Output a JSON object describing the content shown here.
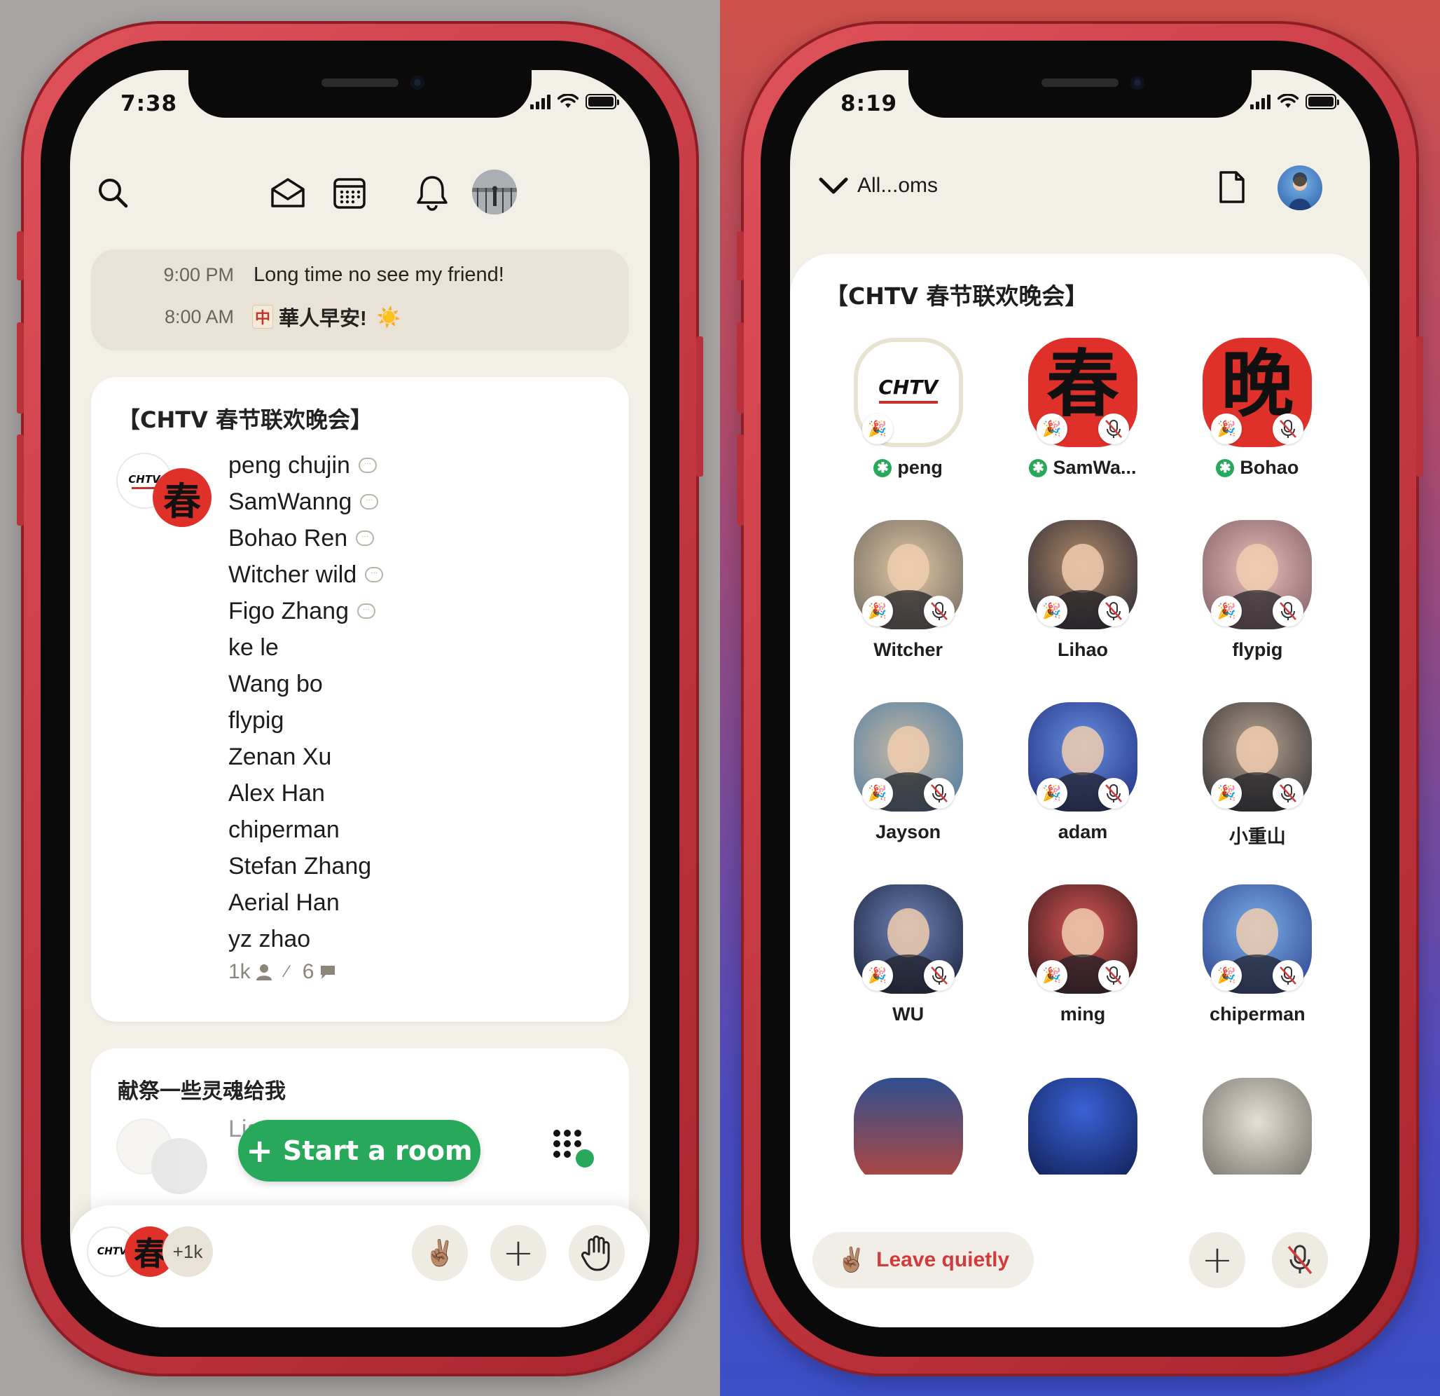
{
  "colors": {
    "accent_green": "#27a85a",
    "leave_red": "#d23b3b",
    "screen_bg": "#f2efe6",
    "phone_red": "#c73a44"
  },
  "left_phone": {
    "status": {
      "time": "7:38"
    },
    "toolbar": {
      "icons": [
        "search-icon",
        "invite-envelope-icon",
        "calendar-icon",
        "bell-icon",
        "profile-avatar"
      ]
    },
    "upcoming": [
      {
        "time": "9:00 PM",
        "title": "Long time no see my friend!",
        "icon": ""
      },
      {
        "time": "8:00 AM",
        "title": "華人早安!",
        "icon": "中",
        "emoji": "☀️"
      }
    ],
    "room": {
      "title": "【CHTV 春节联欢晚会】",
      "speakers": [
        {
          "name": "peng chujin",
          "speaking": true
        },
        {
          "name": "SamWanng",
          "speaking": true
        },
        {
          "name": "Bohao Ren",
          "speaking": true
        },
        {
          "name": "Witcher wild",
          "speaking": true
        },
        {
          "name": "Figo Zhang",
          "speaking": true
        },
        {
          "name": "ke le",
          "speaking": false
        },
        {
          "name": "Wang bo",
          "speaking": false
        },
        {
          "name": "flypig",
          "speaking": false
        },
        {
          "name": "Zenan Xu",
          "speaking": false
        },
        {
          "name": "Alex Han",
          "speaking": false
        },
        {
          "name": "chiperman",
          "speaking": false
        },
        {
          "name": "Stefan Zhang",
          "speaking": false
        },
        {
          "name": "Aerial Han",
          "speaking": false
        },
        {
          "name": "yz zhao",
          "speaking": false
        }
      ],
      "listeners": "1k",
      "speaker_count": "6",
      "avatar1_text": "CHTV",
      "avatar2_text": "春"
    },
    "room2": {
      "title": "献祭一些灵魂给我",
      "first_speaker": "Liang Huan"
    },
    "start_room": {
      "plus": "+",
      "label": "Start a room"
    },
    "bottom": {
      "extra_count": "+1k",
      "peace_emoji": "✌🏽",
      "plus": "+",
      "hand_emoji": "✋"
    }
  },
  "right_phone": {
    "status": {
      "time": "8:19"
    },
    "header": {
      "label": "All...oms"
    },
    "room": {
      "title": "【CHTV 春节联欢晚会】",
      "speakers": [
        {
          "name": "peng",
          "moderator": true,
          "avatar": "chtv-logo"
        },
        {
          "name": "SamWa...",
          "moderator": true,
          "avatar": "chun-char"
        },
        {
          "name": "Bohao",
          "moderator": true,
          "avatar": "wan-char"
        },
        {
          "name": "Witcher",
          "moderator": false,
          "avatar": "photo"
        },
        {
          "name": "Lihao",
          "moderator": false,
          "avatar": "photo"
        },
        {
          "name": "flypig",
          "moderator": false,
          "avatar": "photo"
        },
        {
          "name": "Jayson",
          "moderator": false,
          "avatar": "photo"
        },
        {
          "name": "adam",
          "moderator": false,
          "avatar": "photo"
        },
        {
          "name": "小重山",
          "moderator": false,
          "avatar": "photo"
        },
        {
          "name": "WU",
          "moderator": false,
          "avatar": "photo"
        },
        {
          "name": "ming",
          "moderator": false,
          "avatar": "photo"
        },
        {
          "name": "chiperman",
          "moderator": false,
          "avatar": "photo"
        }
      ],
      "chun_char": "春",
      "wan_char": "晚"
    },
    "bottom": {
      "leave_emoji": "✌🏽",
      "leave_label": "Leave quietly",
      "plus": "+"
    }
  }
}
